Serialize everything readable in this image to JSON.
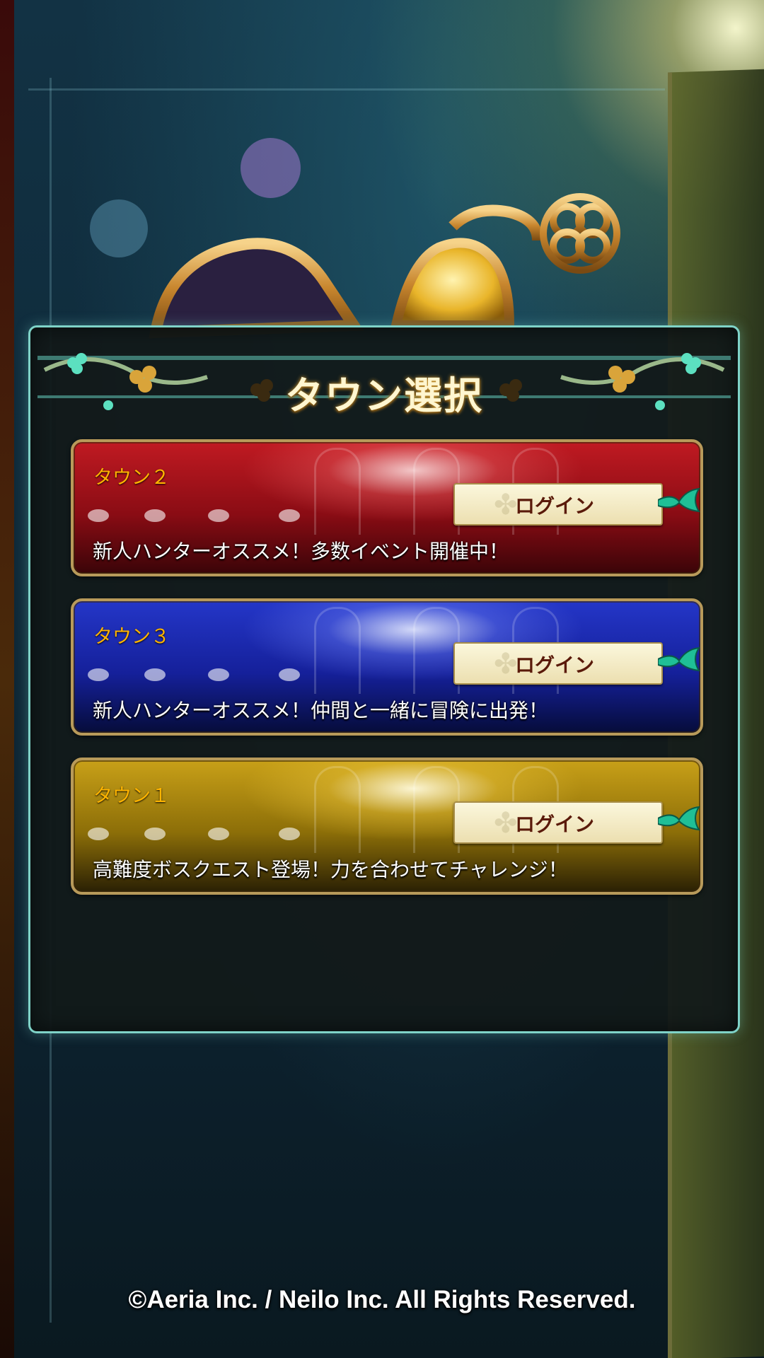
{
  "panel": {
    "title": "タウン選択"
  },
  "towns": [
    {
      "name": "タウン２",
      "login_label": "ログイン",
      "description": "新人ハンターオススメ！多数イベント開催中！",
      "theme_color": "#c01a22"
    },
    {
      "name": "タウン３",
      "login_label": "ログイン",
      "description": "新人ハンターオススメ！仲間と一緒に冒険に出発！",
      "theme_color": "#2436c8"
    },
    {
      "name": "タウン１",
      "login_label": "ログイン",
      "description": "高難度ボスクエスト登場！力を合わせてチャレンジ！",
      "theme_color": "#c8a018"
    }
  ],
  "footer": {
    "copyright": "©Aeria Inc. / Neilo Inc. All Rights Reserved."
  },
  "colors": {
    "panel_border": "#7fd3c8",
    "town_name": "#ffb400",
    "login_text": "#5a1a0a"
  },
  "icons": {
    "clover": "clover-icon",
    "ribbon": "ribbon-icon",
    "emblem": "clover-emblem"
  }
}
